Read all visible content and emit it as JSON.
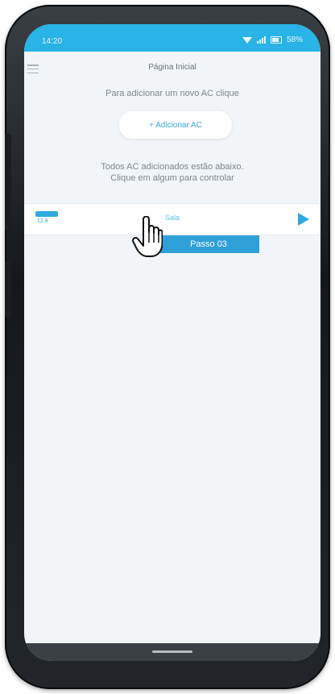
{
  "status_bar": {
    "time": "14:20",
    "battery_text": "58%"
  },
  "header": {
    "title": "Página Inicial"
  },
  "main": {
    "instruction": "Para adicionar um novo AC clique",
    "add_button_label": "+ Adicionar AC",
    "list_hint_line1": "Todos AC adicionados estão abaixo.",
    "list_hint_line2": "Clique em algum para controlar",
    "ac_list": [
      {
        "name": "Sala",
        "temperature": "12.8"
      }
    ]
  },
  "tutorial": {
    "step_label": "Passo 03"
  },
  "icons": {
    "menu": "menu-icon",
    "play": "play-icon",
    "cursor": "hand-pointer-icon",
    "ac": "air-conditioner-icon"
  },
  "colors": {
    "accent": "#2fa9e0",
    "status_bar": "#29b3e6",
    "step_badge": "#2f9fd8"
  }
}
